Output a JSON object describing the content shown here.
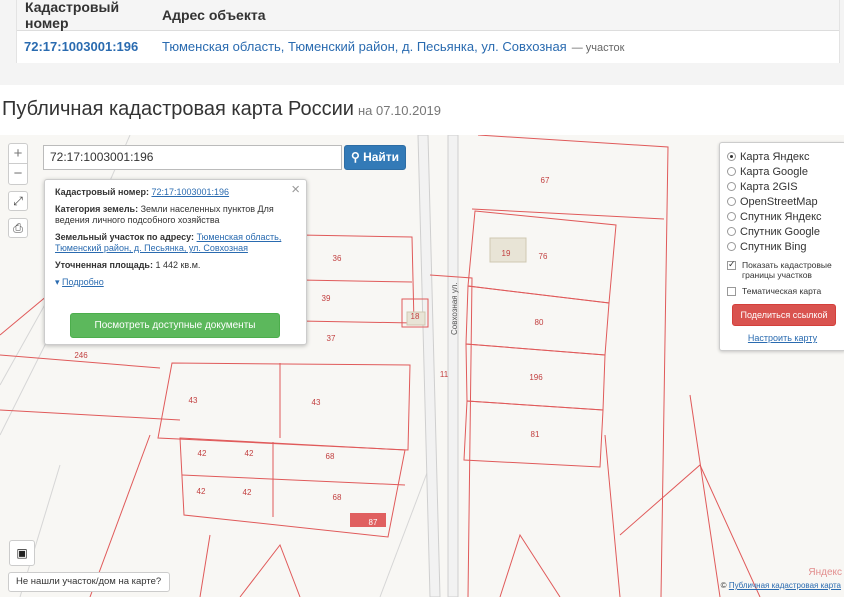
{
  "results": {
    "headers": {
      "cad": "Кадастровый номер",
      "addr": "Адрес объекта"
    },
    "row": {
      "cad": "72:17:1003001:196",
      "addr": "Тюменская область, Тюменский район, д. Песьянка, ул. Совхозная",
      "type": "— участок"
    }
  },
  "page": {
    "title": "Публичная кадастровая карта России",
    "date": "на 07.10.2019"
  },
  "map": {
    "search_value": "72:17:1003001:196",
    "search_button": "Найти",
    "zoom_in": "+",
    "zoom_out": "−",
    "popup": {
      "cad_label": "Кадастровый номер:",
      "cad_value": "72:17:1003001:196",
      "category_label": "Категория земель:",
      "category_value": "Земли населенных пунктов Для ведения личного подсобного хозяйства",
      "address_label": "Земельный участок по адресу:",
      "address_value": "Тюменская область, Тюменский район, д. Песьянка, ул. Совхозная",
      "area_label": "Уточненная площадь:",
      "area_value": "1 442 кв.м.",
      "more_link": "Подробно",
      "docs_button": "Посмотреть доступные документы"
    },
    "layers": {
      "options": [
        "Карта Яндекс",
        "Карта Google",
        "Карта 2GIS",
        "OpenStreetMap",
        "Спутник Яндекс",
        "Спутник Google",
        "Спутник Bing"
      ],
      "selected": "Карта Яндекс",
      "show_borders": "Показать кадастровые границы участков",
      "thematic": "Тематическая карта",
      "share_button": "Поделиться ссылкой",
      "setup_link": "Настроить карту"
    },
    "street_label": "Совхозная ул.",
    "parcel_labels": [
      "67",
      "76",
      "19",
      "80",
      "196",
      "81",
      "36",
      "39",
      "18",
      "37",
      "43",
      "43",
      "42",
      "42",
      "42",
      "42",
      "68",
      "68",
      "246",
      "11",
      "87"
    ],
    "not_found": "Не нашли участок/дом на карте?",
    "copyright_prefix": "©",
    "copyright_link": "Публичная кадастровая карта",
    "yandex": "Яндекс",
    "colors": {
      "parcel": "#e05a5a",
      "road": "#c8c8c8",
      "link": "#2a6bb0",
      "find": "#337ab7",
      "green": "#5cb85c",
      "red": "#d9534f"
    }
  }
}
